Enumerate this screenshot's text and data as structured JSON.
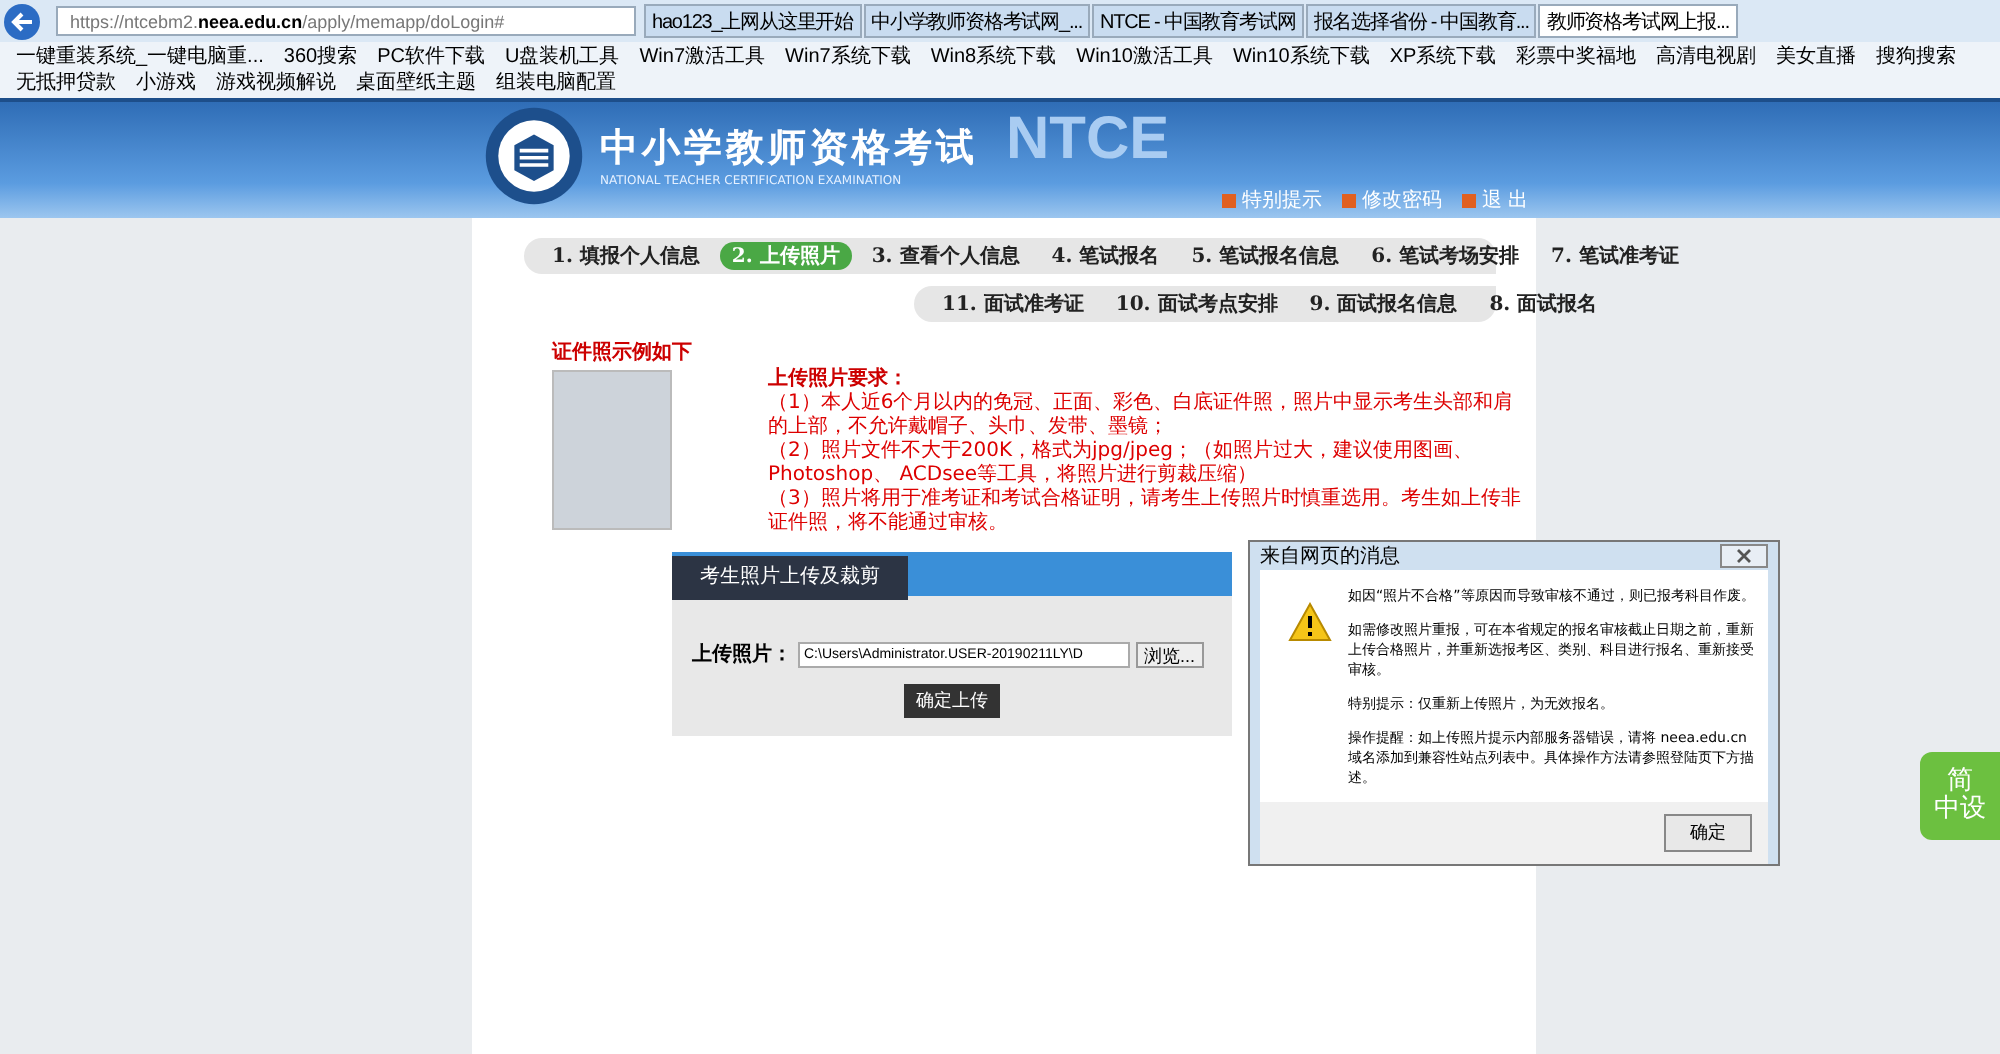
{
  "browser": {
    "address": "https://ntcebm2.**neea.edu.cn**/apply/memapp/doLogin#",
    "tabs": [
      {
        "label": "hao123_上网从这里开始",
        "selected": false
      },
      {
        "label": "中小学教师资格考试网_...",
        "selected": false
      },
      {
        "label": "NTCE - 中国教育考试网",
        "selected": false
      },
      {
        "label": "报名选择省份 - 中国教育...",
        "selected": false
      },
      {
        "label": "教师资格考试网上报...",
        "selected": true
      }
    ],
    "bookmarks": [
      "一键重装系统_一键电脑重...",
      "360搜索",
      "PC软件下载",
      "U盘装机工具",
      "Win7激活工具",
      "Win7系统下载",
      "Win8系统下载",
      "Win10激活工具",
      "Win10系统下载",
      "XP系统下载",
      "彩票中奖福地",
      "高清电视剧",
      "美女直播",
      "搜狗搜索",
      "无抵押贷款",
      "小游戏",
      "游戏视频解说",
      "桌面壁纸主题",
      "组装电脑配置"
    ]
  },
  "header": {
    "bg_text": "NTCE",
    "title": "中小学教师资格考试",
    "subtitle": "NATIONAL TEACHER CERTIFICATION EXAMINATION",
    "links": [
      "特别提示",
      "修改密码",
      "退 出"
    ]
  },
  "steps_row_1": [
    {
      "label": "1. 填报个人信息",
      "selected": false
    },
    {
      "label": "2. 上传照片",
      "selected": true
    },
    {
      "label": "3. 查看个人信息",
      "selected": false
    },
    {
      "label": "4. 笔试报名",
      "selected": false
    },
    {
      "label": "5. 笔试报名信息",
      "selected": false
    },
    {
      "label": "6. 笔试考场安排",
      "selected": false
    },
    {
      "label": "7. 笔试准考证",
      "selected": false
    }
  ],
  "steps_row_2": [
    {
      "label": "11. 面试准考证",
      "selected": false
    },
    {
      "label": "10. 面试考点安排",
      "selected": false
    },
    {
      "label": "9. 面试报名信息",
      "selected": false
    },
    {
      "label": "8. 面试报名",
      "selected": false
    }
  ],
  "sample": {
    "title": "证件照示例如下"
  },
  "requirements": {
    "title": "上传照片要求：",
    "items": [
      "（1）本人近6个月以内的免冠、正面、彩色、白底证件照，照片中显示考生头部和肩的上部，不允许戴帽子、头巾、发带、墨镜；",
      "（2）照片文件不大于200K，格式为jpg/jpeg；（如照片过大，建议使用图画、 Photoshop、 ACDsee等工具，将照片进行剪裁压缩）",
      "（3）照片将用于准考证和考试合格证明，请考生上传照片时慎重选用。考生如上传非证件照，将不能通过审核。"
    ]
  },
  "upload": {
    "tab": "考生照片上传及裁剪",
    "label": "上传照片：",
    "value": "C:\\Users\\Administrator.USER-20190211LY\\D",
    "browse": "浏览...",
    "submit": "确定上传"
  },
  "dialog": {
    "title": "来自网页的消息",
    "paragraphs": [
      "如因“照片不合格”等原因而导致审核不通过，则已报考科目作废。",
      "如需修改照片重报，可在本省规定的报名审核截止日期之前，重新上传合格照片，并重新选报考区、类别、科目进行报名、重新接受审核。",
      "特别提示：仅重新上传照片，为无效报名。",
      "操作提醒：如上传照片提示内部服务器错误，请将 neea.edu.cn 域名添加到兼容性站点列表中。具体操作方法请参照登陆页下方描述。"
    ],
    "ok": "确定"
  },
  "side_widget": {
    "lines": [
      "简",
      "中设"
    ]
  }
}
